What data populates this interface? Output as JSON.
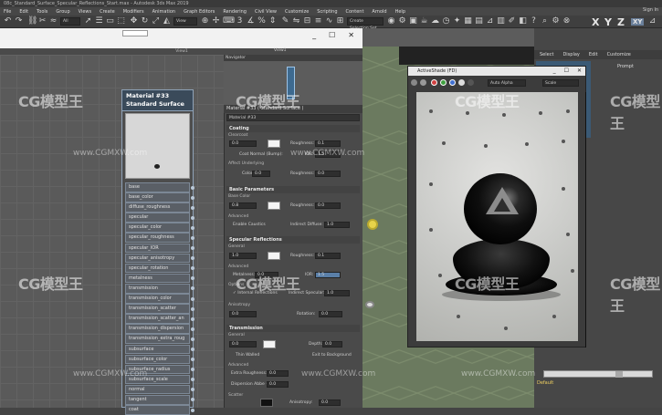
{
  "app": {
    "title": "08c_Standard_Surface_Specular_Reflections_Start.max - Autodesk 3ds Max 2019"
  },
  "menu": [
    "File",
    "Edit",
    "Tools",
    "Group",
    "Views",
    "Create",
    "Modifiers",
    "Animation",
    "Graph Editors",
    "Rendering",
    "Civil View",
    "Customize",
    "Scripting",
    "Content",
    "Arnold",
    "Help"
  ],
  "toolbar": {
    "selection_filter": "All",
    "view_dropdown": "View",
    "named_selection": "Create Selection Set",
    "axes": [
      "X",
      "Y",
      "Z"
    ],
    "axis_highlight": "XY",
    "sign_in": "Sign In"
  },
  "slate": {
    "window_controls": [
      "_",
      "☐",
      "✕"
    ],
    "view_label": "View1",
    "navigator_title": "Navigator",
    "node": {
      "title_line1": "Material #33",
      "title_line2": "Standard Surface",
      "slots": [
        "base",
        "base_color",
        "diffuse_roughness",
        "specular",
        "specular_color",
        "specular_roughness",
        "specular_IOR",
        "specular_anisotropy",
        "specular_rotation",
        "metalness",
        "transmission",
        "transmission_color",
        "transmission_scatter",
        "transmission_scatter_an",
        "transmission_dispersion",
        "transmission_extra_roug",
        "subsurface",
        "subsurface_color",
        "subsurface_radius",
        "subsurface_scale",
        "normal",
        "tangent",
        "coat"
      ]
    }
  },
  "properties": {
    "title": "Material #33 ( Standard Surface )",
    "name": "Material #33",
    "coating": {
      "header": "Coating",
      "clearcoat_label": "Clearcoat",
      "clearcoat_value": "0.0",
      "roughness_label": "Roughness:",
      "roughness_value": "0.1",
      "coat_normal": "Coat Normal (Bump):",
      "ior_label": "IOR:",
      "ior_value": "1.5",
      "affect_underlying": "Affect Underlying",
      "color_label": "Color:",
      "color_value": "0.0",
      "roughness2_label": "Roughness:",
      "roughness2_value": "0.0"
    },
    "basic": {
      "header": "Basic Parameters",
      "base_color": "Base Color",
      "base_value": "0.8",
      "roughness_label": "Roughness:",
      "roughness_value": "0.0",
      "advanced": "Advanced",
      "emit_caustics": "Enable Caustics",
      "indirect_diffuse": "Indirect Diffuse:",
      "indirect_value": "1.0"
    },
    "specular": {
      "header": "Specular Reflections",
      "general": "General",
      "value": "1.0",
      "roughness_label": "Roughness:",
      "roughness_value": "0.1",
      "advanced": "Advanced",
      "metalness_label": "Metalness:",
      "metalness_value": "0.0",
      "ior_label": "IOR:",
      "ior_value": "1.5",
      "options": "Options",
      "internal_reflections": "✓ Internal Reflections",
      "indirect_specular": "Indirect Specular:",
      "indirect_value": "1.0",
      "anisotropy": "Anisotropy",
      "aniso_value": "0.0",
      "rotation_label": "Rotation:",
      "rotation_value": "0.0"
    },
    "transmission": {
      "header": "Transmission",
      "general": "General",
      "value": "0.0",
      "depth_label": "Depth:",
      "depth_value": "0.0",
      "thin_walled": "Thin Walled",
      "exit_to_bg": "Exit to Background",
      "advanced": "Advanced",
      "extra_roughness": "Extra Roughness:",
      "extra_value": "0.0",
      "dispersion": "Dispersion Abbe #:",
      "dispersion_value": "0.0",
      "scatter": "Scatter",
      "anisotropy_label": "Anisotropy:",
      "anisotropy_value": "0.0"
    }
  },
  "render_frame": {
    "title": "ActiveShade (FD)",
    "window_controls": [
      "_",
      "☐",
      "✕"
    ],
    "render_preset": "Auto Alpha",
    "view_select": "Scale"
  },
  "command_panel": {
    "tabs": [
      "Select",
      "Display",
      "Edit",
      "Customize"
    ],
    "expander": "Prompt",
    "default_label": "Default"
  },
  "watermarks": [
    {
      "brand": "CG模型王"
    },
    {
      "brand": "CG模型王"
    },
    {
      "brand": "CG模型王"
    },
    {
      "brand": "CG模型王"
    },
    {
      "brand": "CG模型王"
    },
    {
      "brand": "CG模型王"
    },
    {
      "brand": "CG模型王"
    },
    {
      "brand": "CG模型王"
    }
  ],
  "watermark_urls": [
    "www.CGMXW.com",
    "www.CGMXW.com",
    "www.CGMXW.com",
    "www.CGMXW.com",
    "www.CGMXW.com"
  ],
  "colors": {
    "node_header": "#3a4a5a",
    "node_border": "#8fa3b8",
    "viewport": "#6b7a5f",
    "swatch_white": "#f4f4f4",
    "default_label": "#f0d060"
  }
}
